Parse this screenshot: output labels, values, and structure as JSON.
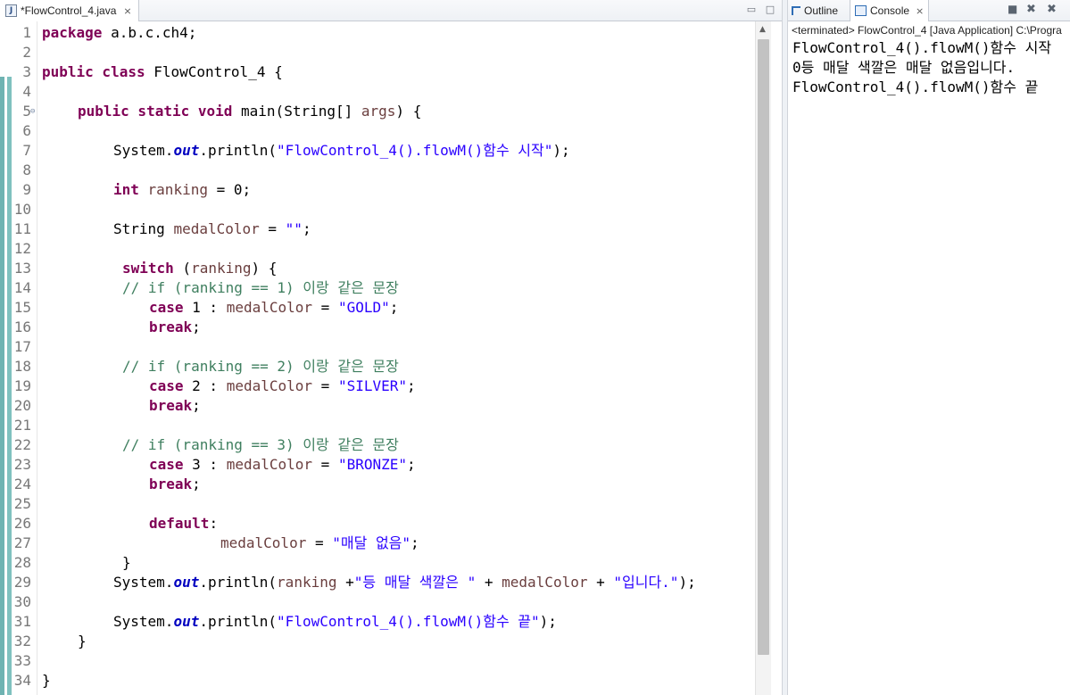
{
  "editor": {
    "tab_title": "*FlowControl_4.java",
    "tab_icon": "java-file-icon",
    "lines": [
      {
        "n": "1"
      },
      {
        "n": "2"
      },
      {
        "n": "3"
      },
      {
        "n": "4"
      },
      {
        "n": "5"
      },
      {
        "n": "6"
      },
      {
        "n": "7"
      },
      {
        "n": "8"
      },
      {
        "n": "9"
      },
      {
        "n": "10"
      },
      {
        "n": "11"
      },
      {
        "n": "12"
      },
      {
        "n": "13"
      },
      {
        "n": "14"
      },
      {
        "n": "15"
      },
      {
        "n": "16"
      },
      {
        "n": "17"
      },
      {
        "n": "18"
      },
      {
        "n": "19"
      },
      {
        "n": "20"
      },
      {
        "n": "21"
      },
      {
        "n": "22"
      },
      {
        "n": "23"
      },
      {
        "n": "24"
      },
      {
        "n": "25"
      },
      {
        "n": "26"
      },
      {
        "n": "27"
      },
      {
        "n": "28"
      },
      {
        "n": "29"
      },
      {
        "n": "30"
      },
      {
        "n": "31"
      },
      {
        "n": "32"
      },
      {
        "n": "33"
      },
      {
        "n": "34"
      }
    ],
    "code": {
      "l1": {
        "kw": "package",
        "rest": " a.b.c.ch4;"
      },
      "l3": {
        "kw": "public class",
        "rest": " FlowControl_4 {"
      },
      "l5": {
        "kw": "public static void",
        "mid": " main(String[] ",
        "var": "args",
        "rest": ") {"
      },
      "l7": {
        "a": "System.",
        "fld": "out",
        "b": ".println(",
        "str": "\"FlowControl_4().flowM()함수 시작\"",
        "c": ");"
      },
      "l9": {
        "kw": "int",
        "var": " ranking",
        "rest": " = 0;"
      },
      "l11": {
        "a": "String ",
        "var": "medalColor",
        "b": " = ",
        "str": "\"\"",
        "c": ";"
      },
      "l13": {
        "kw": "switch",
        "a": " (",
        "var": "ranking",
        "b": ") {"
      },
      "l14": {
        "cm": "// if (ranking == 1) 이랑 같은 문장"
      },
      "l15": {
        "kw": "case",
        "a": " 1 : ",
        "var": "medalColor",
        "b": " = ",
        "str": "\"GOLD\"",
        "c": ";"
      },
      "l16": {
        "kw": "break",
        "a": ";"
      },
      "l18": {
        "cm": "// if (ranking == 2) 이랑 같은 문장"
      },
      "l19": {
        "kw": "case",
        "a": " 2 : ",
        "var": "medalColor",
        "b": " = ",
        "str": "\"SILVER\"",
        "c": ";"
      },
      "l20": {
        "kw": "break",
        "a": ";"
      },
      "l22": {
        "cm": "// if (ranking == 3) 이랑 같은 문장"
      },
      "l23": {
        "kw": "case",
        "a": " 3 : ",
        "var": "medalColor",
        "b": " = ",
        "str": "\"BRONZE\"",
        "c": ";"
      },
      "l24": {
        "kw": "break",
        "a": ";"
      },
      "l26": {
        "kw": "default",
        "a": ":"
      },
      "l27": {
        "var": "medalColor",
        "b": " = ",
        "str": "\"매달 없음\"",
        "c": ";"
      },
      "l28": {
        "a": "}"
      },
      "l29": {
        "a": "System.",
        "fld": "out",
        "b": ".println(",
        "var": "ranking",
        "c": " +",
        "str": "\"등 매달 색깔은 \"",
        "d": " + ",
        "var2": "medalColor",
        "e": " + ",
        "str2": "\"입니다.\"",
        "f": ");"
      },
      "l31": {
        "a": "System.",
        "fld": "out",
        "b": ".println(",
        "str": "\"FlowControl_4().flowM()함수 끝\"",
        "c": ");"
      },
      "l32": {
        "a": "}"
      },
      "l34": {
        "a": "}"
      }
    }
  },
  "console": {
    "outline_tab": "Outline",
    "console_tab": "Console",
    "terminated": "<terminated> FlowControl_4 [Java Application] C:\\Progra",
    "output": [
      "FlowControl_4().flowM()함수 시작",
      "0등 매달 색깔은 매달 없음입니다.",
      "FlowControl_4().flowM()함수 끝"
    ]
  }
}
